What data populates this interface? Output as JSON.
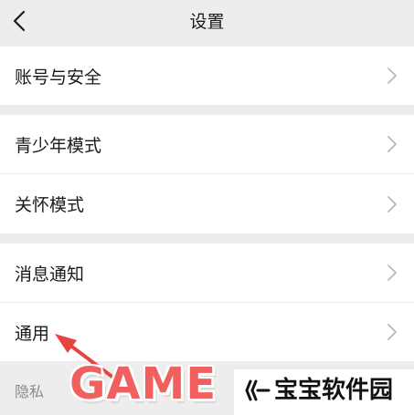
{
  "header": {
    "title": "设置",
    "back_icon": "chevron-left-icon"
  },
  "groups": [
    {
      "items": [
        {
          "label": "账号与安全"
        }
      ]
    },
    {
      "items": [
        {
          "label": "青少年模式"
        },
        {
          "label": "关怀模式"
        }
      ]
    },
    {
      "items": [
        {
          "label": "消息通知"
        },
        {
          "label": "通用"
        }
      ]
    }
  ],
  "section": {
    "label": "隐私"
  },
  "annotation": {
    "arrow_color": "#e8443e",
    "points_to": "通用"
  },
  "watermark": {
    "game_text": "GAME",
    "brand_text": "宝宝软件园",
    "game_color": "#f0605f"
  },
  "colors": {
    "background": "#ededed",
    "row_background": "#ffffff",
    "text": "#1a1a1a",
    "secondary_text": "#8a8a8a",
    "chevron": "#b8b8b8"
  }
}
